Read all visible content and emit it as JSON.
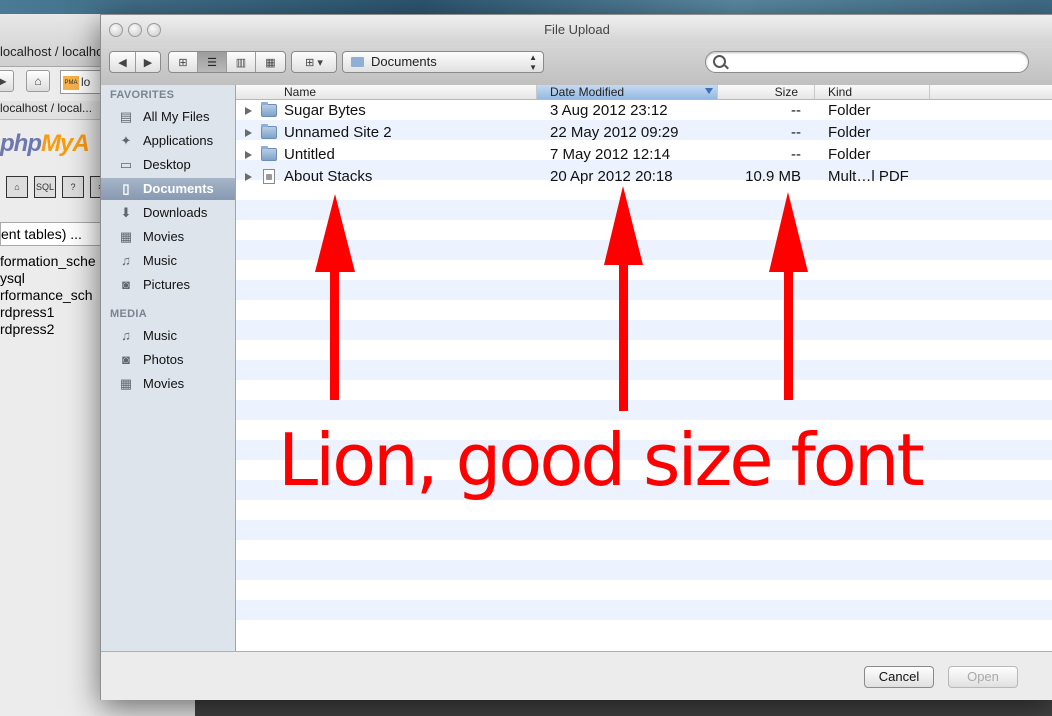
{
  "background": {
    "tab_title": "localhost / localhos",
    "url_fragment": "lo",
    "breadcrumb": "localhost / local...",
    "logo": {
      "php": "php",
      "my": "MyA"
    },
    "pma_icons": [
      "home-icon",
      "sql-icon",
      "help-icon",
      "doc-icon"
    ],
    "db_select_value": "ent tables) ...",
    "databases": [
      "formation_sche",
      "ysql",
      "rformance_sch",
      "rdpress1",
      "rdpress2"
    ],
    "right_fragment_top": "ti",
    "right_fragment_mid": "d"
  },
  "dialog": {
    "title": "File Upload",
    "path_popup": "Documents",
    "search_placeholder": "",
    "sidebar": {
      "favorites_heading": "FAVORITES",
      "favorites": [
        {
          "label": "All My Files",
          "icon": "all-files-icon"
        },
        {
          "label": "Applications",
          "icon": "applications-icon"
        },
        {
          "label": "Desktop",
          "icon": "desktop-icon"
        },
        {
          "label": "Documents",
          "icon": "documents-icon",
          "selected": true
        },
        {
          "label": "Downloads",
          "icon": "downloads-icon"
        },
        {
          "label": "Movies",
          "icon": "movies-icon"
        },
        {
          "label": "Music",
          "icon": "music-icon"
        },
        {
          "label": "Pictures",
          "icon": "pictures-icon"
        }
      ],
      "media_heading": "MEDIA",
      "media": [
        {
          "label": "Music",
          "icon": "music-icon"
        },
        {
          "label": "Photos",
          "icon": "photos-icon"
        },
        {
          "label": "Movies",
          "icon": "movies-icon"
        }
      ]
    },
    "columns": {
      "name": "Name",
      "date": "Date Modified",
      "size": "Size",
      "kind": "Kind"
    },
    "files": [
      {
        "name": "Sugar Bytes",
        "date": "3 Aug 2012 23:12",
        "size": "--",
        "kind": "Folder",
        "icon": "folder-icon"
      },
      {
        "name": "Unnamed Site 2",
        "date": "22 May 2012 09:29",
        "size": "--",
        "kind": "Folder",
        "icon": "folder-icon"
      },
      {
        "name": "Untitled",
        "date": "7 May 2012 12:14",
        "size": "--",
        "kind": "Folder",
        "icon": "folder-icon"
      },
      {
        "name": "About Stacks",
        "date": "20 Apr 2012 20:18",
        "size": "10.9 MB",
        "kind": "Mult…l PDF",
        "icon": "pdf-document-icon"
      }
    ],
    "buttons": {
      "cancel": "Cancel",
      "open": "Open"
    }
  },
  "annotation": {
    "text": "Lion, good size font",
    "color": "#ff0000"
  }
}
